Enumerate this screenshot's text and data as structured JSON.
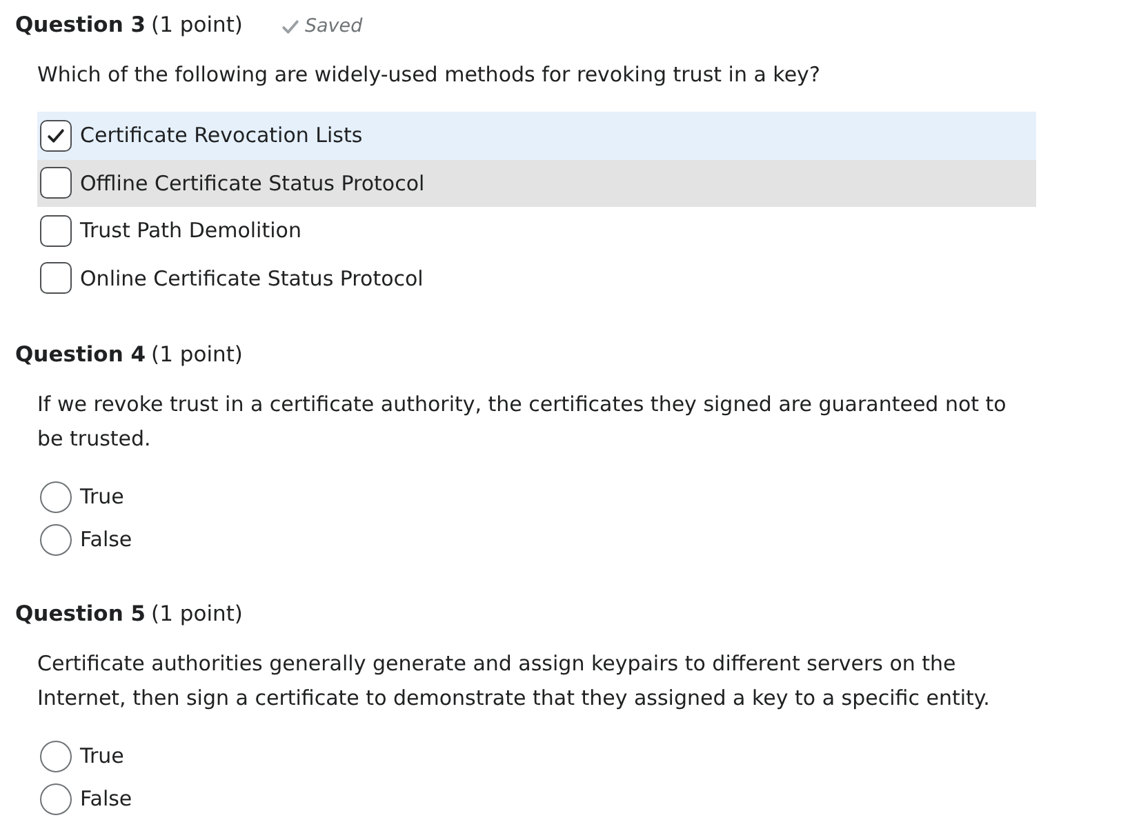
{
  "questions": [
    {
      "title": "Question 3",
      "points": "(1 point)",
      "saved": "Saved",
      "kind": "checkbox",
      "prompt": "Which of the following are widely-used methods for revoking trust in a key?",
      "options": [
        {
          "label": "Certificate Revocation Lists",
          "checked": true,
          "hovered": false
        },
        {
          "label": "Offline Certificate Status Protocol",
          "checked": false,
          "hovered": true
        },
        {
          "label": "Trust Path Demolition",
          "checked": false,
          "hovered": false
        },
        {
          "label": "Online Certificate Status Protocol",
          "checked": false,
          "hovered": false
        }
      ]
    },
    {
      "title": "Question 4",
      "points": "(1 point)",
      "kind": "radio",
      "prompt": "If we revoke trust in a certificate authority, the certificates they signed are guaranteed not to be trusted.",
      "options": [
        {
          "label": "True",
          "checked": false,
          "hovered": false
        },
        {
          "label": "False",
          "checked": false,
          "hovered": false
        }
      ]
    },
    {
      "title": "Question 5",
      "points": "(1 point)",
      "kind": "radio",
      "prompt": "Certificate authorities generally generate and assign keypairs to different servers on the Internet, then sign a certificate to demonstrate that they assigned a key to a specific entity.",
      "options": [
        {
          "label": "True",
          "checked": false,
          "hovered": false
        },
        {
          "label": "False",
          "checked": false,
          "hovered": false
        }
      ]
    }
  ]
}
